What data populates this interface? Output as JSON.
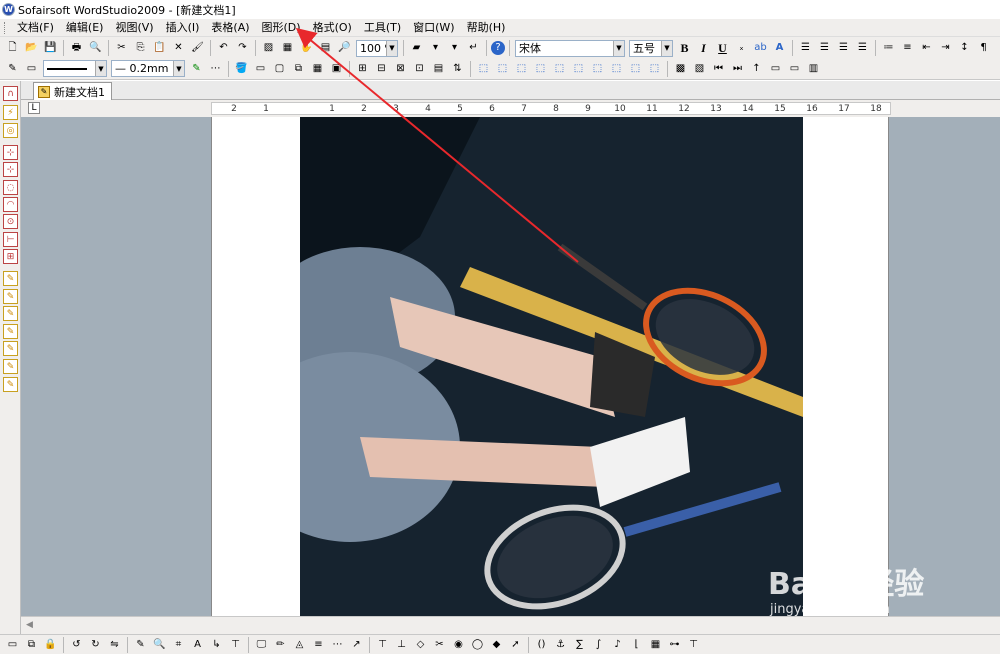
{
  "titlebar": {
    "title": "Sofairsoft WordStudio2009 - [新建文档1]"
  },
  "menu": [
    "文档(F)",
    "编辑(E)",
    "视图(V)",
    "插入(I)",
    "表格(A)",
    "图形(D)",
    "格式(O)",
    "工具(T)",
    "窗口(W)",
    "帮助(H)"
  ],
  "toolbar": {
    "zoom": "100 %",
    "font_name": "宋体",
    "font_size": "五号",
    "bold": "B",
    "italic": "I",
    "underline": "U"
  },
  "toolbar2": {
    "line_width": "0.2mm"
  },
  "document": {
    "tab_title": "新建文档1"
  },
  "ruler": {
    "marks": [
      "2",
      "1",
      "1",
      "2",
      "3",
      "4",
      "5",
      "6",
      "7",
      "8",
      "9",
      "10",
      "11",
      "12",
      "13",
      "14",
      "15",
      "16",
      "17",
      "18"
    ]
  },
  "watermark": {
    "text": "Baidu经验",
    "sub": "jingyan.baidu.com"
  },
  "colors": {
    "annotation": "#e8282c",
    "workspace": "#a3afb9",
    "court": "#14222f"
  }
}
